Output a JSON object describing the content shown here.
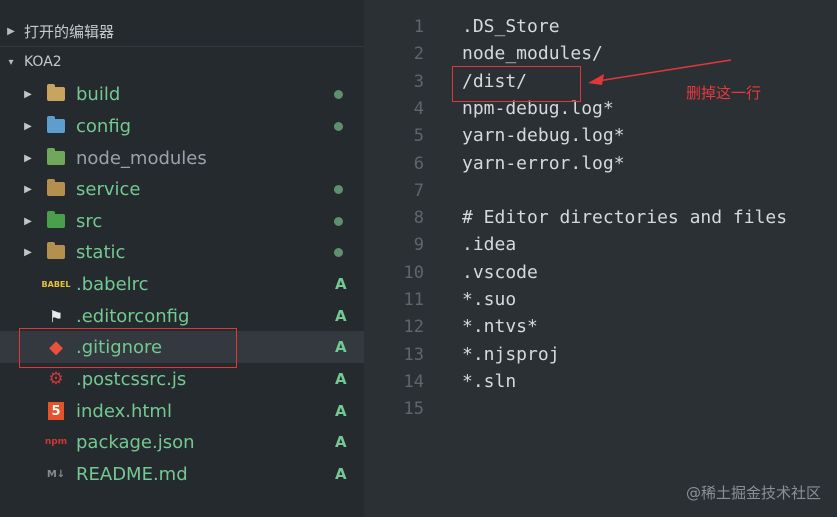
{
  "sidebar": {
    "open_editors_label": "打开的编辑器",
    "project_label": "KOA2",
    "items": [
      {
        "label": "build",
        "type": "folder",
        "icon": "folder-build-icon",
        "status": "dot"
      },
      {
        "label": "config",
        "type": "folder",
        "icon": "folder-config-icon",
        "status": "dot"
      },
      {
        "label": "node_modules",
        "type": "folder",
        "icon": "folder-node-icon",
        "status": ""
      },
      {
        "label": "service",
        "type": "folder",
        "icon": "folder-icon",
        "status": "dot"
      },
      {
        "label": "src",
        "type": "folder",
        "icon": "folder-src-icon",
        "status": "dot"
      },
      {
        "label": "static",
        "type": "folder",
        "icon": "folder-icon",
        "status": "dot"
      },
      {
        "label": ".babelrc",
        "type": "file",
        "icon": "babel-icon",
        "status": "A"
      },
      {
        "label": ".editorconfig",
        "type": "file",
        "icon": "editorconfig-icon",
        "status": "A"
      },
      {
        "label": ".gitignore",
        "type": "file",
        "icon": "git-icon",
        "status": "A"
      },
      {
        "label": ".postcssrc.js",
        "type": "file",
        "icon": "postcss-icon",
        "status": "A"
      },
      {
        "label": "index.html",
        "type": "file",
        "icon": "html5-icon",
        "status": "A"
      },
      {
        "label": "package.json",
        "type": "file",
        "icon": "npm-icon",
        "status": "A"
      },
      {
        "label": "README.md",
        "type": "file",
        "icon": "markdown-icon",
        "status": "A"
      }
    ]
  },
  "editor": {
    "lines": [
      {
        "n": "1",
        "text": ".DS_Store"
      },
      {
        "n": "2",
        "text": "node_modules/"
      },
      {
        "n": "3",
        "text": "/dist/"
      },
      {
        "n": "4",
        "text": "npm-debug.log*"
      },
      {
        "n": "5",
        "text": "yarn-debug.log*"
      },
      {
        "n": "6",
        "text": "yarn-error.log*"
      },
      {
        "n": "7",
        "text": ""
      },
      {
        "n": "8",
        "text": "# Editor directories and files"
      },
      {
        "n": "9",
        "text": ".idea"
      },
      {
        "n": "10",
        "text": ".vscode"
      },
      {
        "n": "11",
        "text": "*.suo"
      },
      {
        "n": "12",
        "text": "*.ntvs*"
      },
      {
        "n": "13",
        "text": "*.njsproj"
      },
      {
        "n": "14",
        "text": "*.sln"
      },
      {
        "n": "15",
        "text": ""
      }
    ]
  },
  "annotation": {
    "text": "删掉这一行"
  },
  "watermark": "@稀土掘金技术社区",
  "colors": {
    "highlight": "#e0383a",
    "git_added": "#73c991"
  }
}
